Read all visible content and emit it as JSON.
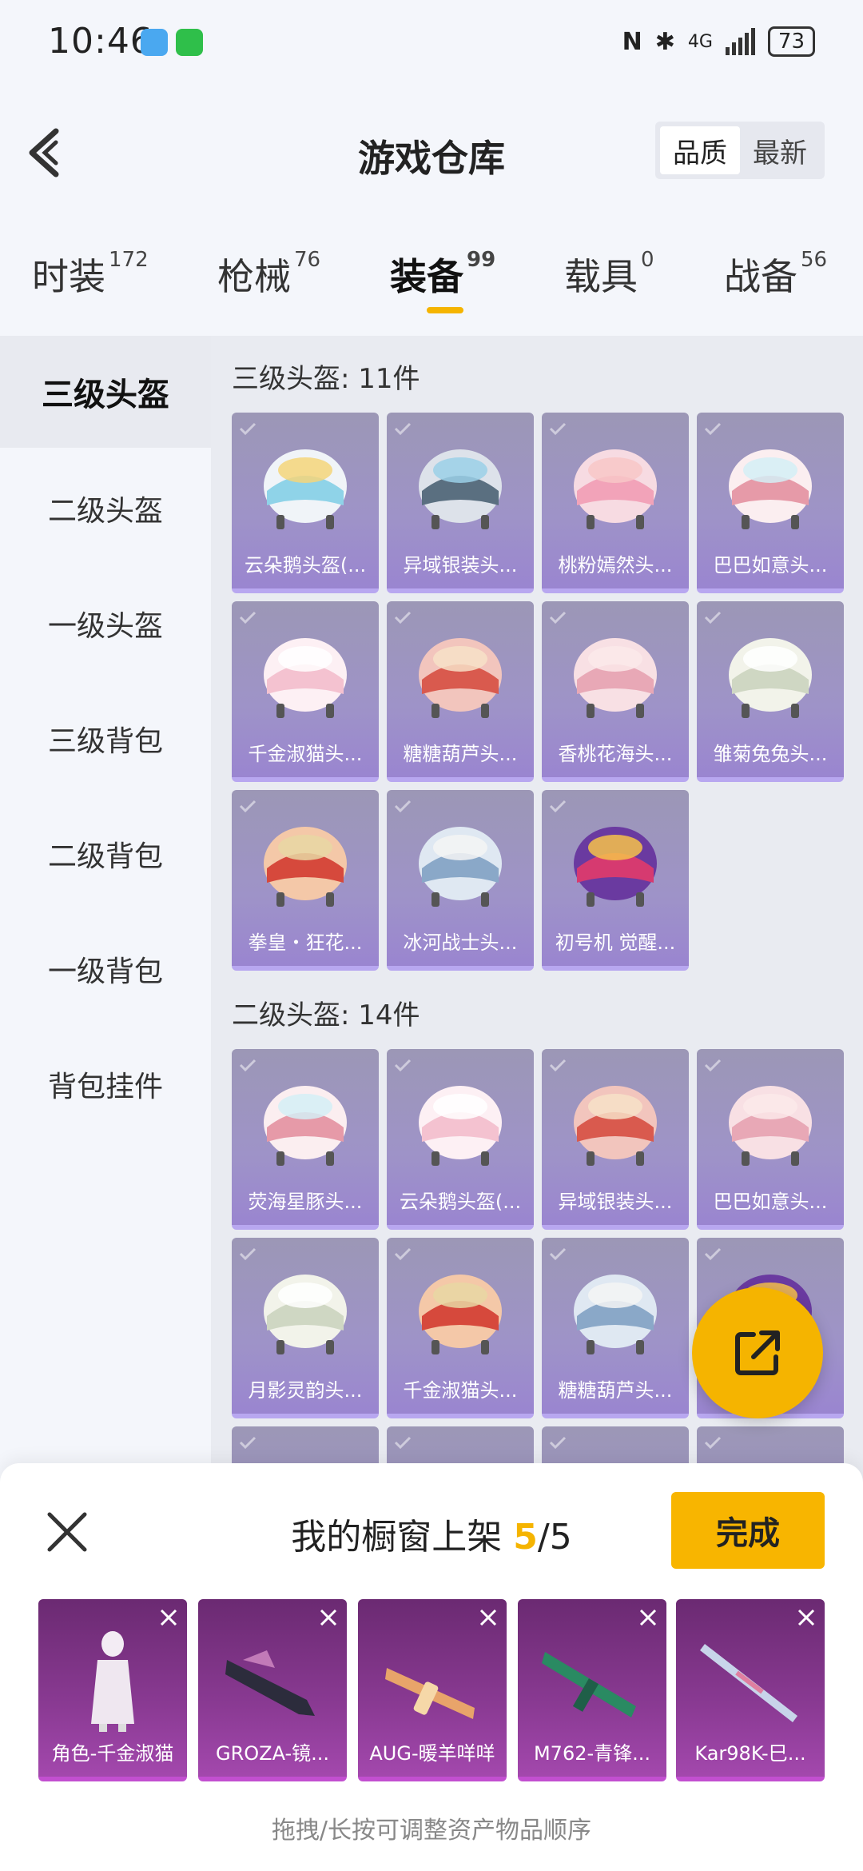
{
  "status_bar": {
    "time": "10:46",
    "network": "4G",
    "battery": "73"
  },
  "header": {
    "title": "游戏仓库",
    "sort_options": [
      "品质",
      "最新"
    ],
    "active_sort": "品质"
  },
  "tabs": [
    {
      "label": "时装",
      "count": "172"
    },
    {
      "label": "枪械",
      "count": "76"
    },
    {
      "label": "装备",
      "count": "99"
    },
    {
      "label": "载具",
      "count": "0"
    },
    {
      "label": "战备",
      "count": "56"
    }
  ],
  "active_tab": "装备",
  "sidebar": {
    "items": [
      "三级头盔",
      "二级头盔",
      "一级头盔",
      "三级背包",
      "二级背包",
      "一级背包",
      "背包挂件"
    ],
    "active": "三级头盔"
  },
  "sections": [
    {
      "title": "三级头盔: 11件",
      "items": [
        "云朵鹅头盔(...",
        "异域银装头...",
        "桃粉嫣然头...",
        "巴巴如意头...",
        "千金淑猫头...",
        "糖糖葫芦头...",
        "香桃花海头...",
        "雏菊兔兔头...",
        "拳皇・狂花...",
        "冰河战士头...",
        "初号机 觉醒..."
      ]
    },
    {
      "title": "二级头盔: 14件",
      "items": [
        "荧海星豚头...",
        "云朵鹅头盔(...",
        "异域银装头...",
        "巴巴如意头...",
        "月影灵韵头...",
        "千金淑猫头...",
        "糖糖葫芦头...",
        "",
        "",
        "",
        "",
        ""
      ]
    }
  ],
  "bottom_panel": {
    "title_prefix": "我的橱窗上架 ",
    "count_current": "5",
    "count_sep_total": "/5",
    "done_label": "完成",
    "hint": "拖拽/长按可调整资产物品顺序",
    "shelf_items": [
      "角色-千金淑猫",
      "GROZA-镜...",
      "AUG-暖羊咩咩",
      "M762-青锋...",
      "Kar98K-巳..."
    ]
  },
  "colors": {
    "accent": "#f5b400",
    "card_purple": "#9e93c8",
    "shelf_purple": "#8a3a93"
  }
}
